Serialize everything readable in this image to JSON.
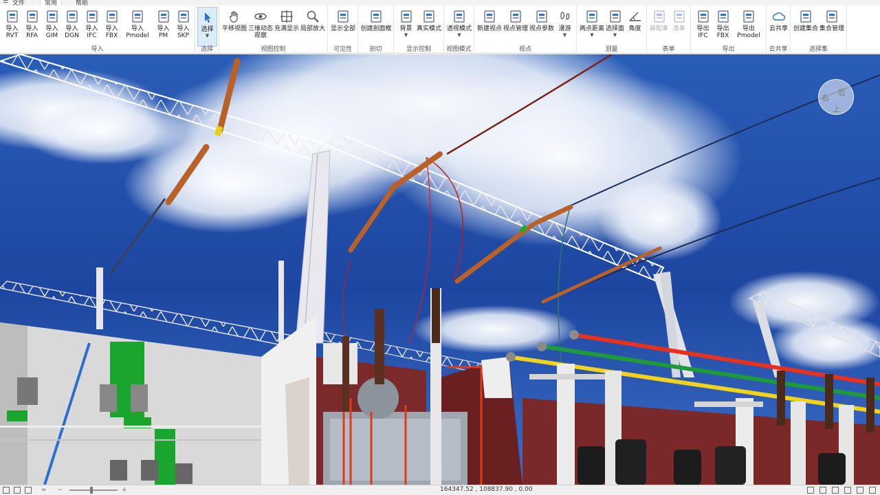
{
  "menu": {
    "items": [
      {
        "label": "☰"
      },
      {
        "label": "文件"
      },
      {
        "label": "常用"
      },
      {
        "label": "帮助"
      }
    ]
  },
  "ribbon": {
    "groups": [
      {
        "label": "导入",
        "buttons": [
          {
            "label": "导入\nRVT",
            "icon": "import-rvt-icon"
          },
          {
            "label": "导入\nRFA",
            "icon": "import-rfa-icon"
          },
          {
            "label": "导入\nGIM",
            "icon": "import-gim-icon"
          },
          {
            "label": "导入\nDGN",
            "icon": "import-dgn-icon"
          },
          {
            "label": "导入\nIFC",
            "icon": "import-ifc-icon"
          },
          {
            "label": "导入\nFBX",
            "icon": "import-fbx-icon"
          },
          {
            "label": "导入\nPmodel",
            "icon": "import-pmodel-icon"
          },
          {
            "label": "导入\nPM",
            "icon": "import-pm-icon"
          },
          {
            "label": "导入\nSKP",
            "icon": "import-skp-icon"
          }
        ]
      },
      {
        "label": "选择",
        "buttons": [
          {
            "label": "选择",
            "icon": "cursor-icon",
            "active": true,
            "caret": true
          }
        ]
      },
      {
        "label": "视图控制",
        "buttons": [
          {
            "label": "平移视图",
            "icon": "hand-icon"
          },
          {
            "label": "三维动态\n观察",
            "icon": "orbit-icon"
          },
          {
            "label": "充满显示",
            "icon": "zoom-extents-icon"
          },
          {
            "label": "局部放大",
            "icon": "zoom-window-icon"
          }
        ]
      },
      {
        "label": "可见性",
        "buttons": [
          {
            "label": "显示全部",
            "icon": "show-all-icon"
          }
        ]
      },
      {
        "label": "剖切",
        "buttons": [
          {
            "label": "创建剖面框",
            "icon": "section-box-icon"
          }
        ]
      },
      {
        "label": "显示控制",
        "buttons": [
          {
            "label": "背景",
            "icon": "background-icon",
            "caret": true
          },
          {
            "label": "真实模式",
            "icon": "realistic-mode-icon"
          }
        ]
      },
      {
        "label": "视图模式",
        "buttons": [
          {
            "label": "透视模式",
            "icon": "perspective-icon",
            "caret": true
          }
        ]
      },
      {
        "label": "视点",
        "buttons": [
          {
            "label": "新建视点",
            "icon": "new-viewpoint-icon"
          },
          {
            "label": "视点管理",
            "icon": "viewpoint-manage-icon"
          },
          {
            "label": "视点参数",
            "icon": "viewpoint-params-icon"
          },
          {
            "label": "漫游",
            "icon": "walk-icon",
            "caret": true
          }
        ]
      },
      {
        "label": "测量",
        "buttons": [
          {
            "label": "两点距离",
            "icon": "measure-distance-icon",
            "caret": true
          },
          {
            "label": "选择面",
            "icon": "select-face-icon",
            "caret": true
          },
          {
            "label": "角度",
            "icon": "angle-icon"
          }
        ]
      },
      {
        "label": "表单",
        "buttons": [
          {
            "label": "装配率",
            "icon": "assembly-rate-icon",
            "disabled": true
          },
          {
            "label": "清单",
            "icon": "list-icon",
            "disabled": true
          }
        ]
      },
      {
        "label": "导出",
        "buttons": [
          {
            "label": "导出\nIFC",
            "icon": "export-ifc-icon"
          },
          {
            "label": "导出\nFBX",
            "icon": "export-fbx-icon"
          },
          {
            "label": "导出\nPmodel",
            "icon": "export-pmodel-icon"
          }
        ]
      },
      {
        "label": "云共享",
        "buttons": [
          {
            "label": "云共享",
            "icon": "cloud-share-icon"
          }
        ]
      },
      {
        "label": "选择集",
        "buttons": [
          {
            "label": "创建集合",
            "icon": "create-set-icon"
          },
          {
            "label": "集合管理",
            "icon": "set-manage-icon"
          }
        ]
      }
    ]
  },
  "navcube": {
    "top": "右",
    "right": "后",
    "bottom": "上"
  },
  "status": {
    "coords": "164347.52 , 108837.90 , 0.00",
    "zoom_minus": "−",
    "zoom_plus": "+"
  },
  "colors": {
    "ribbon_active": "#dcebf8",
    "sky": "#1f4fa8",
    "phase_red": "#e8321e",
    "phase_green": "#1f9a3a",
    "phase_yellow": "#f2d21b",
    "insulator": "#b8622a"
  }
}
